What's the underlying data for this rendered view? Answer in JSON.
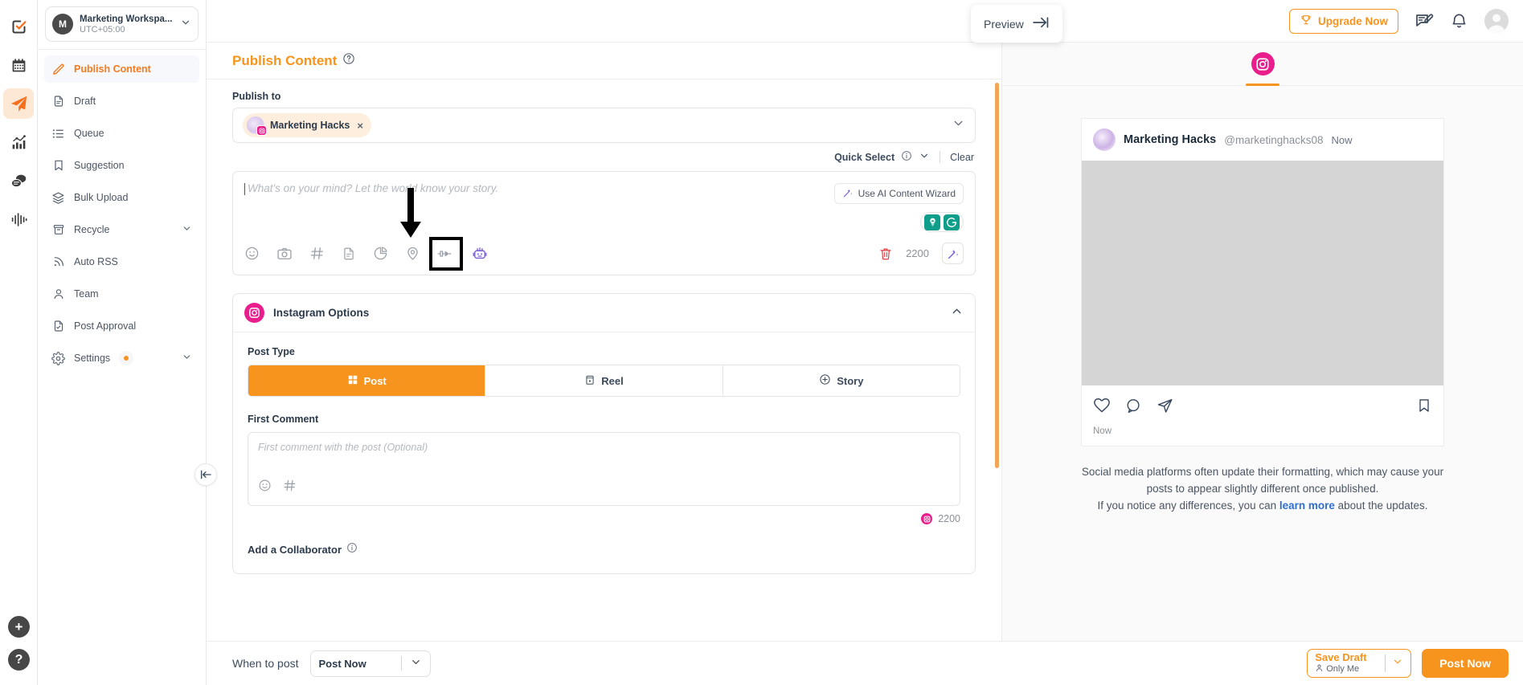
{
  "workspace": {
    "avatar_initial": "M",
    "name": "Marketing Workspa...",
    "timezone": "UTC+05:00"
  },
  "rail": {
    "items": [
      {
        "name": "tasks-icon",
        "label": "Tasks"
      },
      {
        "name": "calendar-icon",
        "label": "Calendar"
      },
      {
        "name": "publish-icon",
        "label": "Publish"
      },
      {
        "name": "analytics-icon",
        "label": "Analytics"
      },
      {
        "name": "inbox-icon",
        "label": "Inbox"
      },
      {
        "name": "listening-icon",
        "label": "Listening"
      }
    ],
    "add_label": "+",
    "help_label": "?"
  },
  "sidebar": {
    "items": [
      {
        "label": "Publish Content",
        "icon": "pencil-icon",
        "active": true
      },
      {
        "label": "Draft",
        "icon": "document-icon",
        "active": false
      },
      {
        "label": "Queue",
        "icon": "list-icon",
        "active": false
      },
      {
        "label": "Suggestion",
        "icon": "bookmark-icon",
        "active": false
      },
      {
        "label": "Bulk Upload",
        "icon": "layers-icon",
        "active": false
      },
      {
        "label": "Recycle",
        "icon": "archive-icon",
        "active": false
      },
      {
        "label": "Auto RSS",
        "icon": "rss-icon",
        "active": false
      },
      {
        "label": "Team",
        "icon": "user-icon",
        "active": false
      },
      {
        "label": "Post Approval",
        "icon": "doc-check-icon",
        "active": false
      },
      {
        "label": "Settings",
        "icon": "gear-icon",
        "active": false
      }
    ]
  },
  "topbar": {
    "upgrade_label": "Upgrade Now"
  },
  "editor": {
    "title": "Publish Content",
    "publish_to_label": "Publish to",
    "account_chip": {
      "name": "Marketing Hacks",
      "remove": "×"
    },
    "quick_select_label": "Quick Select",
    "clear_label": "Clear",
    "composer": {
      "placeholder": "What's on your mind? Let the world know your story.",
      "ai_wizard_label": "Use AI Content Wizard",
      "char_count": "2200",
      "tools": [
        "emoji-icon",
        "camera-icon",
        "hashtag-icon",
        "document-icon",
        "poll-icon",
        "location-icon",
        "plug-icon",
        "bot-icon"
      ]
    },
    "instagram_options": {
      "title": "Instagram Options",
      "post_type_label": "Post Type",
      "post_types": [
        {
          "label": "Post",
          "icon": "grid-icon",
          "active": true
        },
        {
          "label": "Reel",
          "icon": "reel-icon",
          "active": false
        },
        {
          "label": "Story",
          "icon": "plus-circle-icon",
          "active": false
        }
      ],
      "first_comment_label": "First Comment",
      "first_comment_placeholder": "First comment with the post (Optional)",
      "first_comment_count": "2200",
      "collaborator_label": "Add a Collaborator"
    }
  },
  "preview": {
    "tab_label": "Preview",
    "platform": "instagram",
    "post": {
      "display_name": "Marketing Hacks",
      "handle": "@marketinghacks08",
      "time_top": "Now",
      "time_bottom": "Now"
    },
    "note_line1": "Social media platforms often update their formatting, which may cause your",
    "note_line2": "posts to appear slightly different once published.",
    "note_line3_pre": "If you notice any differences, you can ",
    "note_link": "learn more",
    "note_line3_post": " about the updates."
  },
  "bottom": {
    "when_label": "When to post",
    "when_value": "Post Now",
    "save_draft_label": "Save Draft",
    "save_draft_sub": "Only Me",
    "post_now_label": "Post Now"
  },
  "colors": {
    "accent": "#f7941e",
    "instagram": "#e91e8c",
    "link": "#2f6fd0"
  }
}
